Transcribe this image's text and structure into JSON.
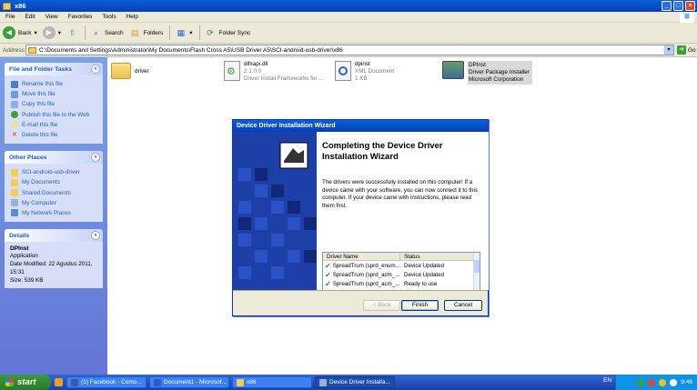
{
  "window": {
    "title": "x86"
  },
  "menu": [
    "File",
    "Edit",
    "View",
    "Favorites",
    "Tools",
    "Help"
  ],
  "toolbar": {
    "back": "Back",
    "search": "Search",
    "folders": "Folders",
    "folder_sync": "Folder Sync"
  },
  "address": {
    "label": "Address",
    "path": "C:\\Documents and Settings\\Administrator\\My Documents\\Flash Cross A5\\USB Driver A5\\SCI-android-usb-driver\\x86",
    "go": "Go"
  },
  "sidebar": {
    "tasks_title": "File and Folder Tasks",
    "tasks": [
      "Rename this file",
      "Move this file",
      "Copy this file",
      "Publish this file to the Web",
      "E-mail this file",
      "Delete this file"
    ],
    "places_title": "Other Places",
    "places": [
      "SCI-android-usb-driver",
      "My Documents",
      "Shared Documents",
      "My Computer",
      "My Network Places"
    ],
    "details_title": "Details",
    "details": {
      "name": "DPInst",
      "type": "Application",
      "modified": "Date Modified: 22 Agustus 2011, 15:31",
      "size": "Size: 539 KB"
    }
  },
  "files": [
    {
      "name": "driver",
      "meta1": "",
      "meta2": ""
    },
    {
      "name": "difxapi.dll",
      "meta1": "2.1.0.0",
      "meta2": "Driver Install Frameworks for ..."
    },
    {
      "name": "dpinst",
      "meta1": "XML Document",
      "meta2": "1 KB"
    },
    {
      "name": "DPInst",
      "meta1": "Driver Package Installer",
      "meta2": "Microsoft Corporation"
    }
  ],
  "wizard": {
    "title": "Device Driver Installation Wizard",
    "heading": "Completing the Device Driver Installation Wizard",
    "message": "The drivers were successfully installed on this computer! If a device came with your software, you can now connect it to this computer. If your device came with instructions, please read them first.",
    "col_driver": "Driver Name",
    "col_status": "Status",
    "rows": [
      {
        "name": "SpreadTrum (sprd_enum...",
        "status": "Device Updated"
      },
      {
        "name": "SpreadTrum (sprd_acm_...",
        "status": "Device Updated"
      },
      {
        "name": "SpreadTrum (sprd_acm_...",
        "status": "Ready to use"
      }
    ],
    "back": "< Back",
    "finish": "Finish",
    "cancel": "Cancel"
  },
  "taskbar": {
    "start": "start",
    "tasks": [
      "(1) Facebook - Como...",
      "Document1 - Microsof...",
      "x86",
      "Device Driver Installa..."
    ],
    "lang": "EN",
    "time": "9:46"
  }
}
